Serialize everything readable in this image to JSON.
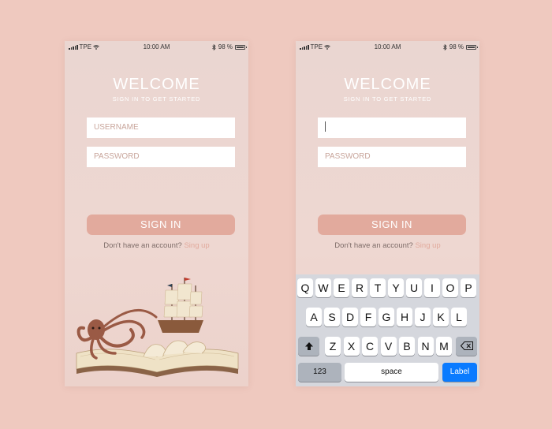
{
  "status": {
    "carrier": "TPE",
    "time": "10:00 AM",
    "battery": "98 %"
  },
  "welcome": {
    "title": "WELCOME",
    "subtitle": "SIGN IN TO GET STARTED"
  },
  "form": {
    "username_placeholder": "USERNAME",
    "password_placeholder": "PASSWORD",
    "signin_label": "SIGN IN",
    "account_prompt": "Don't have an account?",
    "signup_link": "Sing up"
  },
  "keyboard": {
    "row1": [
      "Q",
      "W",
      "E",
      "R",
      "T",
      "Y",
      "U",
      "I",
      "O",
      "P"
    ],
    "row2": [
      "A",
      "S",
      "D",
      "F",
      "G",
      "H",
      "J",
      "K",
      "L"
    ],
    "row3": [
      "Z",
      "X",
      "C",
      "V",
      "B",
      "N",
      "M"
    ],
    "numbers_label": "123",
    "space_label": "space",
    "return_label": "Label"
  },
  "colors": {
    "background": "#efc9bf",
    "accent": "#e2aa9d",
    "keyboard_blue": "#0a7bff"
  }
}
